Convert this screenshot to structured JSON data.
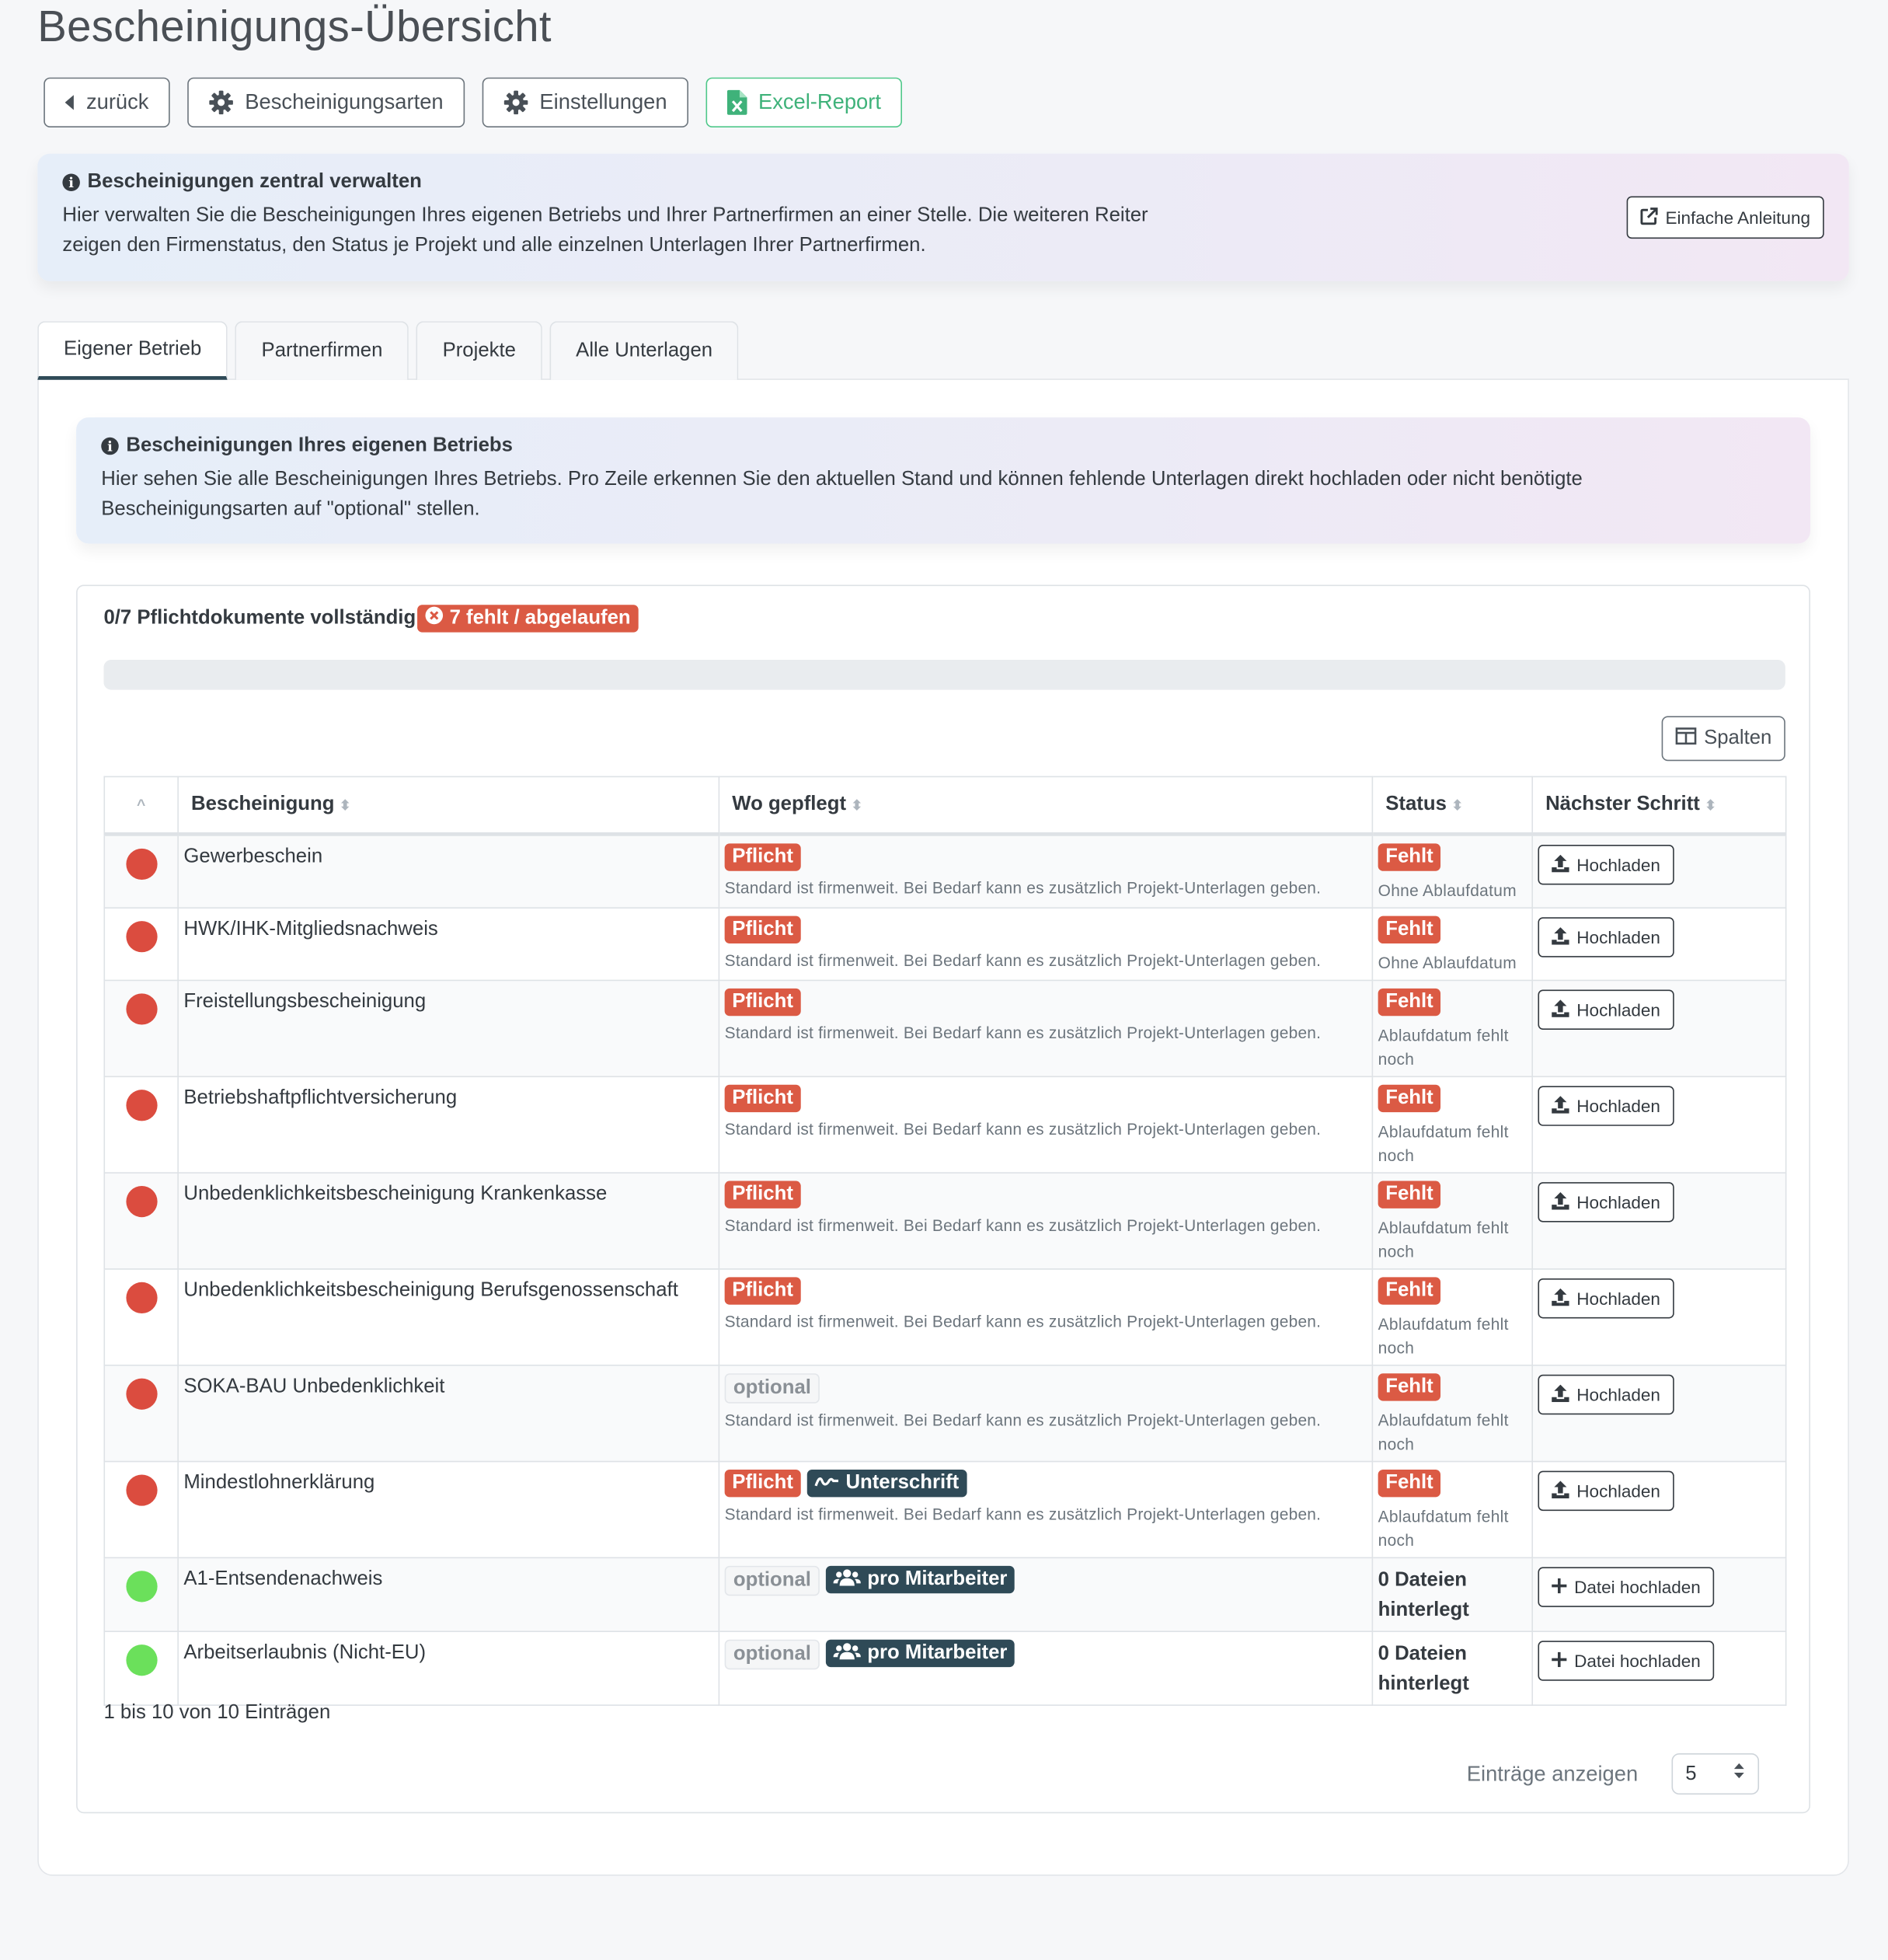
{
  "page": {
    "title": "Bescheinigungs-Übersicht"
  },
  "toolbar": {
    "back_label": "zurück",
    "types_label": "Bescheinigungsarten",
    "settings_label": "Einstellungen",
    "excel_label": "Excel-Report"
  },
  "top_alert": {
    "heading": "Bescheinigungen zentral verwalten",
    "text_line1": "Hier verwalten Sie die Bescheinigungen Ihres eigenen Betriebs und Ihrer Partnerfirmen an einer Stelle. Die weiteren Reiter",
    "text_line2": "zeigen den Firmenstatus, den Status je Projekt und alle einzelnen Unterlagen Ihrer Partnerfirmen.",
    "guide_label": "Einfache Anleitung"
  },
  "tabs": [
    {
      "label": "Eigener Betrieb",
      "active": true
    },
    {
      "label": "Partnerfirmen",
      "active": false
    },
    {
      "label": "Projekte",
      "active": false
    },
    {
      "label": "Alle Unterlagen",
      "active": false
    }
  ],
  "inner_alert": {
    "heading": "Bescheinigungen Ihres eigenen Betriebs",
    "text_line1": "Hier sehen Sie alle Bescheinigungen Ihres Betriebs. Pro Zeile erkennen Sie den aktuellen Stand und können fehlende Unterlagen direkt hochladen oder nicht benötigte",
    "text_line2": "Bescheinigungsarten auf \"optional\" stellen."
  },
  "summary": {
    "text": "0/7 Pflichtdokumente vollständig",
    "badge": "7 fehlt / abgelaufen",
    "progress": 0
  },
  "columns_button": "Spalten",
  "table": {
    "headers": [
      "",
      "Bescheinigung",
      "Wo gepflegt",
      "Status",
      "Nächster Schritt"
    ],
    "rows": [
      {
        "status_color": "red",
        "name": "Gewerbeschein",
        "tag": "Pflicht",
        "extra_tag": "",
        "note": "Standard ist firmenweit. Bei Bedarf kann es zusätzlich Projekt-Unterlagen geben.",
        "status": "Fehlt",
        "status_note": "Ohne Ablaufdatum",
        "action": "Hochladen"
      },
      {
        "status_color": "red",
        "name": "HWK/IHK-Mitgliedsnachweis",
        "tag": "Pflicht",
        "extra_tag": "",
        "note": "Standard ist firmenweit. Bei Bedarf kann es zusätzlich Projekt-Unterlagen geben.",
        "status": "Fehlt",
        "status_note": "Ohne Ablaufdatum",
        "action": "Hochladen"
      },
      {
        "status_color": "red",
        "name": "Freistellungsbescheinigung",
        "tag": "Pflicht",
        "extra_tag": "",
        "note": "Standard ist firmenweit. Bei Bedarf kann es zusätzlich Projekt-Unterlagen geben.",
        "status": "Fehlt",
        "status_note": "Ablaufdatum fehlt noch",
        "action": "Hochladen"
      },
      {
        "status_color": "red",
        "name": "Betriebshaftpflichtversicherung",
        "tag": "Pflicht",
        "extra_tag": "",
        "note": "Standard ist firmenweit. Bei Bedarf kann es zusätzlich Projekt-Unterlagen geben.",
        "status": "Fehlt",
        "status_note": "Ablaufdatum fehlt noch",
        "action": "Hochladen"
      },
      {
        "status_color": "red",
        "name": "Unbedenklichkeitsbescheinigung Krankenkasse",
        "tag": "Pflicht",
        "extra_tag": "",
        "note": "Standard ist firmenweit. Bei Bedarf kann es zusätzlich Projekt-Unterlagen geben.",
        "status": "Fehlt",
        "status_note": "Ablaufdatum fehlt noch",
        "action": "Hochladen"
      },
      {
        "status_color": "red",
        "name": "Unbedenklichkeitsbescheinigung Berufsgenossenschaft",
        "tag": "Pflicht",
        "extra_tag": "",
        "note": "Standard ist firmenweit. Bei Bedarf kann es zusätzlich Projekt-Unterlagen geben.",
        "status": "Fehlt",
        "status_note": "Ablaufdatum fehlt noch",
        "action": "Hochladen"
      },
      {
        "status_color": "red",
        "name": "SOKA-BAU Unbedenklichkeit",
        "tag": "optional",
        "extra_tag": "",
        "note": "Standard ist firmenweit. Bei Bedarf kann es zusätzlich Projekt-Unterlagen geben.",
        "status": "Fehlt",
        "status_note": "Ablaufdatum fehlt noch",
        "action": "Hochladen"
      },
      {
        "status_color": "red",
        "name": "Mindestlohnerklärung",
        "tag": "Pflicht",
        "extra_tag": "Unterschrift",
        "note": "Standard ist firmenweit. Bei Bedarf kann es zusätzlich Projekt-Unterlagen geben.",
        "status": "Fehlt",
        "status_note": "Ablaufdatum fehlt noch",
        "action": "Hochladen"
      },
      {
        "status_color": "green",
        "name": "A1-Entsendenachweis",
        "tag": "optional",
        "extra_tag": "pro Mitarbeiter",
        "note": "",
        "status": "",
        "status_note": "0 Dateien hinterlegt",
        "action": "Datei hochladen"
      },
      {
        "status_color": "green",
        "name": "Arbeitserlaubnis (Nicht-EU)",
        "tag": "optional",
        "extra_tag": "pro Mitarbeiter",
        "note": "",
        "status": "",
        "status_note": "0 Dateien hinterlegt",
        "action": "Datei hochladen"
      }
    ]
  },
  "footer": {
    "info": "1 bis 10 von 10 Einträgen",
    "length_label": "Einträge anzeigen",
    "length_value": "5"
  },
  "colors": {
    "red": "#db4c3f",
    "green": "#6be05b",
    "dark": "#2f4a57",
    "excel": "#3fb27a"
  }
}
